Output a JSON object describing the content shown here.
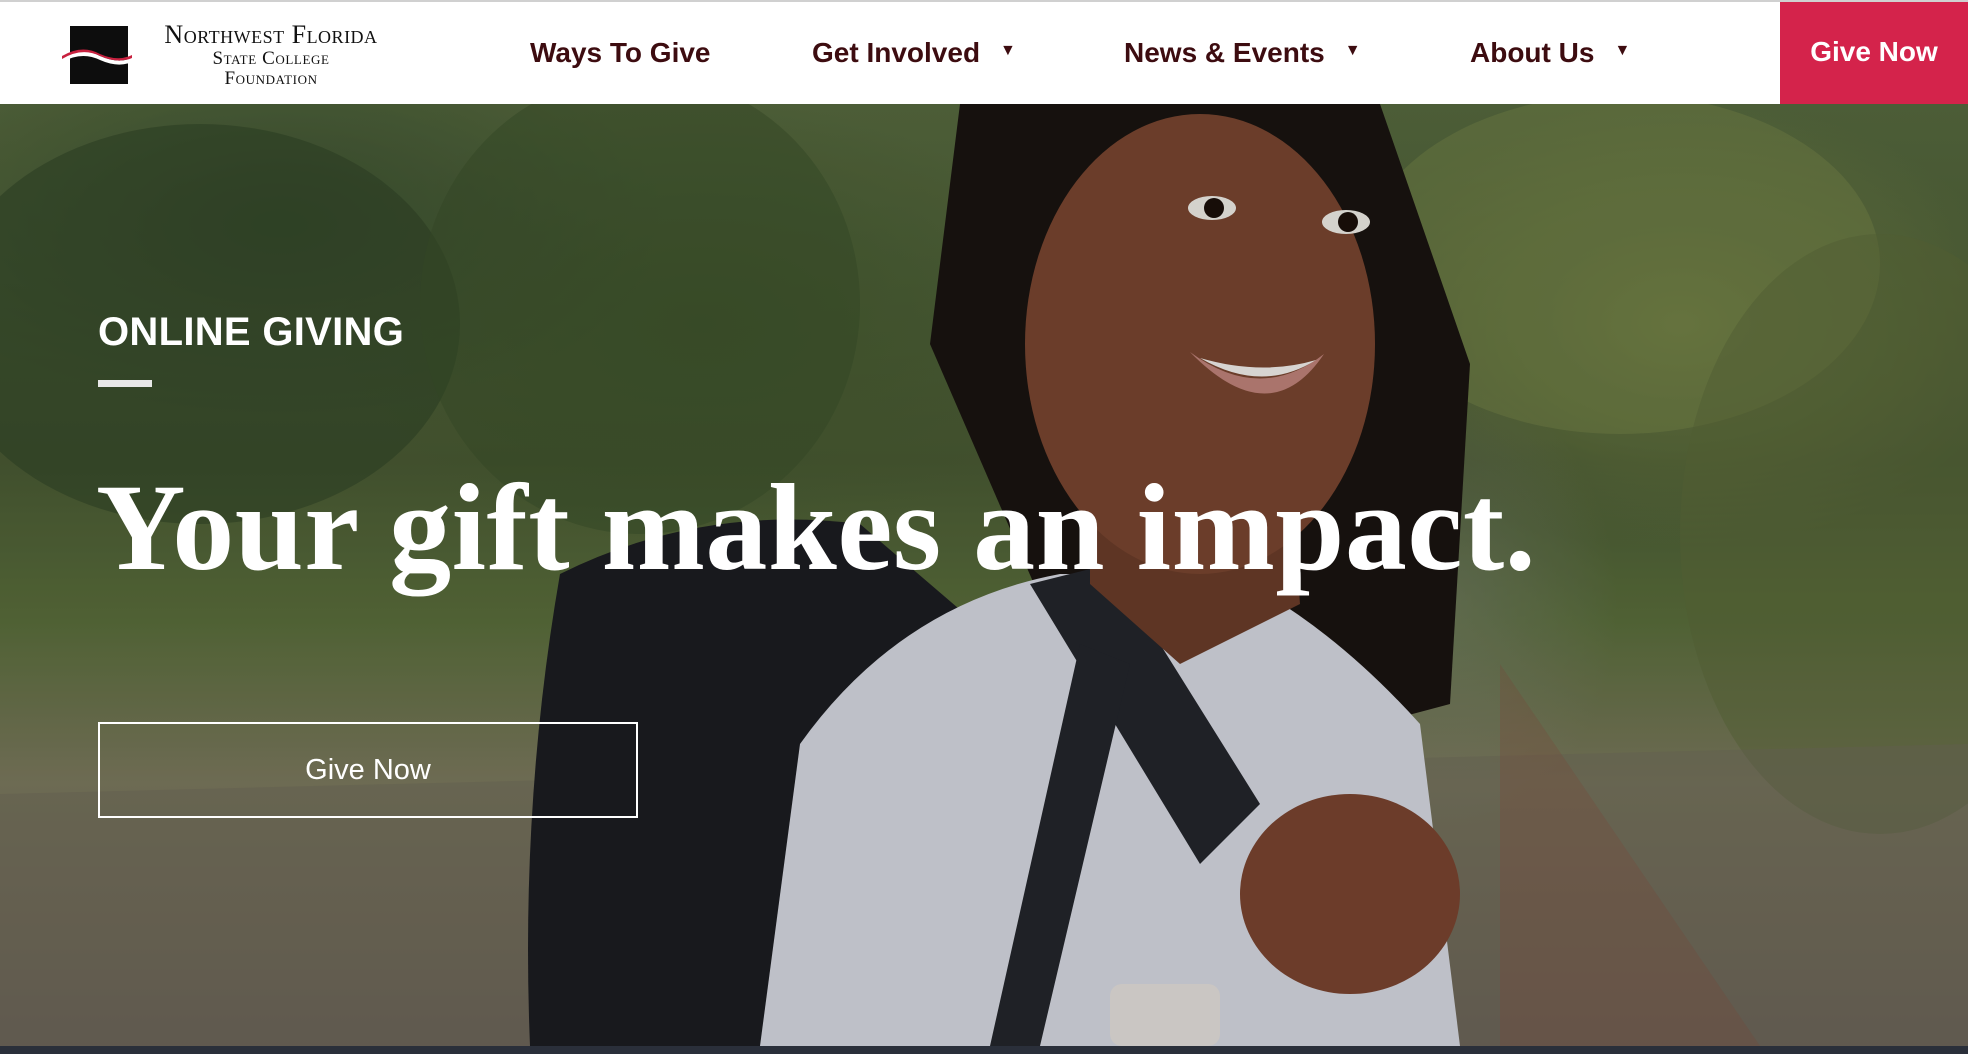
{
  "header": {
    "logo": {
      "line1": "Northwest Florida",
      "line2": "State College",
      "line3": "Foundation"
    },
    "nav": [
      {
        "label": "Ways To Give",
        "has_dropdown": false
      },
      {
        "label": "Get Involved",
        "has_dropdown": true
      },
      {
        "label": "News & Events",
        "has_dropdown": true
      },
      {
        "label": "About Us",
        "has_dropdown": true
      }
    ],
    "caret_glyph": "▼",
    "give_now_label": "Give Now"
  },
  "hero": {
    "eyebrow": "ONLINE GIVING",
    "headline": "Your gift makes an impact.",
    "cta_label": "Give Now",
    "image": "hero-photo-student-with-backpack"
  },
  "colors": {
    "brand_red": "#d4234b",
    "nav_text": "#3d0c10",
    "hero_text": "#ffffff",
    "footer_strip": "#2a2f3a"
  }
}
